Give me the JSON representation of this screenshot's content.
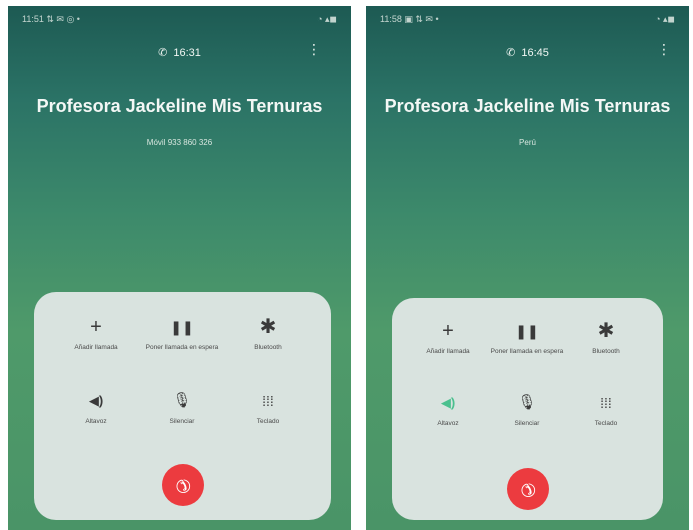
{
  "screens": [
    {
      "status_time": "11:51 ⇅ ✉ ◎ •",
      "status_right": "◔ ▴◼",
      "call_timer": "16:31",
      "contact_name": "Profesora Jackeline Mis Ternuras",
      "contact_sub": "Móvil 933 860 326",
      "buttons": [
        {
          "icon": "+",
          "label": "Añadir llamada"
        },
        {
          "icon": "❚❚",
          "label": "Poner llamada en espera"
        },
        {
          "icon": "✱",
          "label": "Bluetooth"
        },
        {
          "icon": "◀)",
          "label": "Altavoz"
        },
        {
          "icon": "🎙",
          "label": "Silenciar"
        },
        {
          "icon": "⁞⁞⁞",
          "label": "Teclado"
        }
      ]
    },
    {
      "status_time": "11:58 ▣ ⇅ ✉ •",
      "status_right": "◔ ▴◼",
      "call_timer": "16:45",
      "contact_name": "Profesora Jackeline Mis Ternuras",
      "contact_sub": "Perú",
      "buttons": [
        {
          "icon": "+",
          "label": "Añadir llamada"
        },
        {
          "icon": "❚❚",
          "label": "Poner llamada en espera"
        },
        {
          "icon": "✱",
          "label": "Bluetooth"
        },
        {
          "icon": "◀)",
          "label": "Altavoz",
          "active": true
        },
        {
          "icon": "🎙",
          "label": "Silenciar"
        },
        {
          "icon": "⁞⁞⁞",
          "label": "Teclado"
        }
      ]
    }
  ],
  "colors": {
    "end_call": "#ec3b3f",
    "speaker_active": "#4ac08e",
    "panel": "#d9e3df"
  }
}
